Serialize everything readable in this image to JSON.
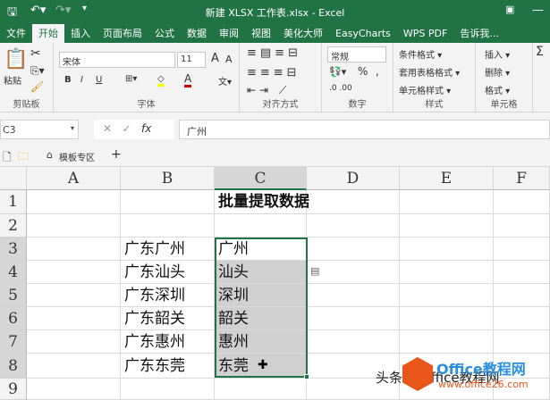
{
  "title": "新建 XLSX 工作表.xlsx - Excel",
  "tabs": [
    "文件",
    "开始",
    "插入",
    "页面布局",
    "公式",
    "数据",
    "审阅",
    "视图",
    "美化大师",
    "EasyCharts",
    "WPS PDF",
    "告诉我..."
  ],
  "active_tab": "开始",
  "ribbon": {
    "clipboard": {
      "paste": "粘贴",
      "label": "剪贴板"
    },
    "font": {
      "name": "宋体",
      "size": "11",
      "bold": "B",
      "italic": "I",
      "underline": "U",
      "grow": "A",
      "shrink": "A",
      "color": "A",
      "label": "字体"
    },
    "alignment": {
      "label": "对齐方式"
    },
    "number": {
      "format": "常规",
      "percent": "%",
      "comma": ",",
      "label": "数字"
    },
    "styles": {
      "conditional": "条件格式 ▾",
      "table": "套用表格格式 ▾",
      "cell": "单元格样式 ▾",
      "label": "样式"
    },
    "cells": {
      "insert": "插入 ▾",
      "delete": "删除 ▾",
      "format": "格式 ▾",
      "label": "单元格"
    }
  },
  "formula_bar": {
    "name_box": "C3",
    "value": "广州",
    "fx": "fx"
  },
  "sheet_tabs": {
    "template": "模板专区",
    "add": "+"
  },
  "columns": [
    "A",
    "B",
    "C",
    "D",
    "E",
    "F"
  ],
  "rows": [
    "1",
    "2",
    "3",
    "4",
    "5",
    "6",
    "7",
    "8",
    "9"
  ],
  "cells": {
    "C1": "批量提取数据",
    "B3": "广东广州",
    "C3": "广州",
    "B4": "广东汕头",
    "C4": "汕头",
    "B5": "广东深圳",
    "C5": "深圳",
    "B6": "广东韶关",
    "C6": "韶关",
    "B7": "广东惠州",
    "C7": "惠州",
    "B8": "广东东莞",
    "C8": "东莞"
  },
  "watermark": {
    "text": "头条 @Office教程网",
    "brand": "Office教程网",
    "url": "www.office26.com"
  }
}
